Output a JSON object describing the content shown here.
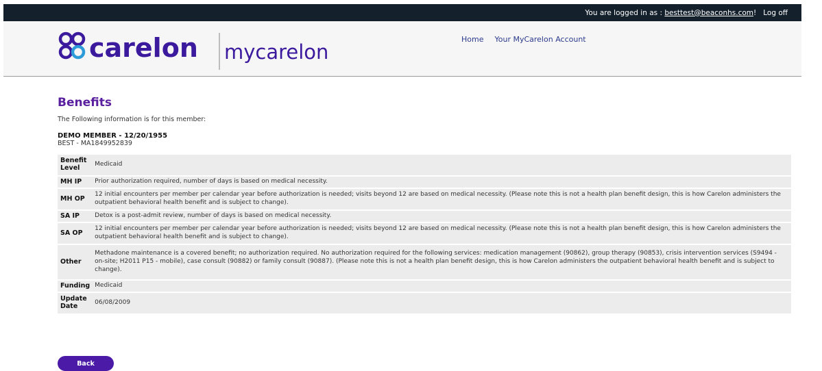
{
  "topbar": {
    "login_prefix": "You are logged in as : ",
    "login_email": "besttest@beaconhs.com",
    "login_suffix": "!",
    "logoff": "Log off"
  },
  "logo": {
    "brand": "carelon",
    "product": "mycarelon",
    "brand_color": "#3b1a9e"
  },
  "nav": {
    "home": "Home",
    "account": "Your MyCarelon Account"
  },
  "page": {
    "title": "Benefits",
    "intro": "The Following information is for this member:",
    "member_name": "DEMO MEMBER - 12/20/1955",
    "member_id": "BEST - MA1849952839"
  },
  "benefits": [
    {
      "label": "Benefit Level",
      "value": "Medicaid"
    },
    {
      "label": "MH IP",
      "value": "Prior authorization required, number of days is based on medical necessity."
    },
    {
      "label": "MH OP",
      "value": "12 initial encounters per member per calendar year before authorization is needed; visits beyond 12 are based on medical necessity. (Please note this is not a health plan benefit design, this is how Carelon administers the outpatient behavioral health benefit and is subject to change)."
    },
    {
      "label": "SA IP",
      "value": "Detox is a post-admit review, number of days is based on medical necessity."
    },
    {
      "label": "SA OP",
      "value": "12 initial encounters per member per calendar year before authorization is needed; visits beyond 12 are based on medical necessity. (Please note this is not a health plan benefit design, this is how Carelon administers the outpatient behavioral health benefit and is subject to change)."
    },
    {
      "label": "Other",
      "value": "Methadone maintenance is a covered benefit; no authorization required. No authorization required for the following services: medication management (90862), group therapy (90853), crisis intervention services (S9494 - on-site; H2011 P15 - mobile), case consult (90882) or family consult (90887). (Please note this is not a health plan benefit design, this is how Carelon administers the outpatient behavioral health benefit and is subject to change)."
    },
    {
      "label": "Funding",
      "value": "Medicaid"
    },
    {
      "label": "Update Date",
      "value": "06/08/2009"
    }
  ],
  "actions": {
    "back": "Back"
  }
}
